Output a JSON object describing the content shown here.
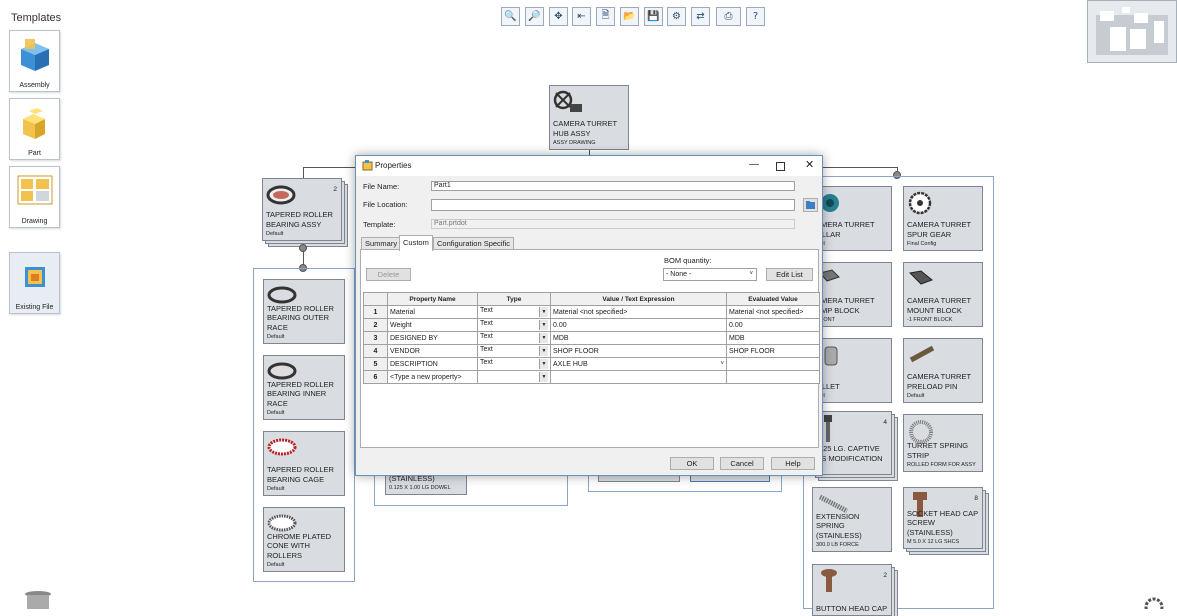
{
  "templates": {
    "title": "Templates",
    "items": [
      {
        "label": "Assembly",
        "icon": "assembly-icon"
      },
      {
        "label": "Part",
        "icon": "part-icon"
      },
      {
        "label": "Drawing",
        "icon": "drawing-icon"
      }
    ],
    "existing_file": "Existing File"
  },
  "toolbar": [
    "zoom-icon",
    "zoom-fit-icon",
    "pan-icon",
    "import-icon",
    "new-document-icon",
    "open-icon",
    "save-icon",
    "properties-icon",
    "replace-icon",
    "print-icon",
    "help-icon"
  ],
  "root": {
    "title": "CAMERA TURRET HUB ASSY",
    "sub": "ASSY DRAWING"
  },
  "left_group": [
    {
      "title": "TAPERED ROLLER BEARING ASSY",
      "sub": "Default",
      "count": "2"
    },
    {
      "title": "TAPERED ROLLER BEARING OUTER RACE",
      "sub": "Default"
    },
    {
      "title": "TAPERED ROLLER BEARING INNER RACE",
      "sub": "Default"
    },
    {
      "title": "TAPERED ROLLER BEARING CAGE",
      "sub": "Default"
    },
    {
      "title": "CHROME PLATED CONE WITH ROLLERS",
      "sub": "Default"
    }
  ],
  "right_col1": [
    {
      "title": "AMERA TURRET OLLAR",
      "sub": "ault"
    },
    {
      "title": "AMERA TURRET AMP BLOCK",
      "sub": "FRONT"
    },
    {
      "title": "OLLET",
      "sub": "ault"
    },
    {
      "title": "X 25 LG. CAPTIVE CS MODIFICATION",
      "sub": "",
      "count": "4"
    },
    {
      "title": "EXTENSION SPRING (STAINLESS)",
      "sub": "300.0 LB FORCE"
    },
    {
      "title": "BUTTON HEAD CAP",
      "sub": "",
      "count": "2"
    }
  ],
  "right_col2": [
    {
      "title": "CAMERA TURRET SPUR GEAR",
      "sub": "Final Config"
    },
    {
      "title": "CAMERA TURRET MOUNT BLOCK",
      "sub": "-1 FRONT BLOCK"
    },
    {
      "title": "CAMERA TURRET PRELOAD PIN",
      "sub": "Default"
    },
    {
      "title": "TURRET SPRING STRIP",
      "sub": "ROLLED FORM FOR ASSY"
    },
    {
      "title": "SOCKET HEAD CAP SCREW (STAINLESS)",
      "sub": "M 5.0 X 12 LG SHCS",
      "count": "8"
    }
  ],
  "hidden_partials": {
    "dowel_title": "(STAINLESS)",
    "dowel_sub": "0.125 X 1.00 LG DOWEL",
    "default1": "DEFAULT",
    "default2": "Default"
  },
  "dialog": {
    "title": "Properties",
    "file_name_label": "File Name:",
    "file_name": "Part1",
    "file_location_label": "File Location:",
    "file_location": "",
    "template_label": "Template:",
    "template": "Part.prtdot",
    "tabs": [
      "Summary",
      "Custom",
      "Configuration Specific"
    ],
    "delete": "Delete",
    "bom_label": "BOM quantity:",
    "bom_value": "- None -",
    "edit_list": "Edit List",
    "columns": [
      "",
      "Property Name",
      "Type",
      "Value / Text Expression",
      "Evaluated Value"
    ],
    "rows": [
      {
        "n": "1",
        "name": "Material",
        "type": "Text",
        "value": "Material <not specified>",
        "eval": "Material <not specified>"
      },
      {
        "n": "2",
        "name": "Weight",
        "type": "Text",
        "value": "0.00",
        "eval": "0.00"
      },
      {
        "n": "3",
        "name": "DESIGNED BY",
        "type": "Text",
        "value": "MDB",
        "eval": "MDB"
      },
      {
        "n": "4",
        "name": "VENDOR",
        "type": "Text",
        "value": "SHOP FLOOR",
        "eval": "SHOP FLOOR"
      },
      {
        "n": "5",
        "name": "DESCRIPTION",
        "type": "Text",
        "value": "AXLE HUB",
        "eval": ""
      },
      {
        "n": "6",
        "name": "<Type a new property>",
        "type": "",
        "value": "",
        "eval": ""
      }
    ],
    "ok": "OK",
    "cancel": "Cancel",
    "help": "Help"
  }
}
